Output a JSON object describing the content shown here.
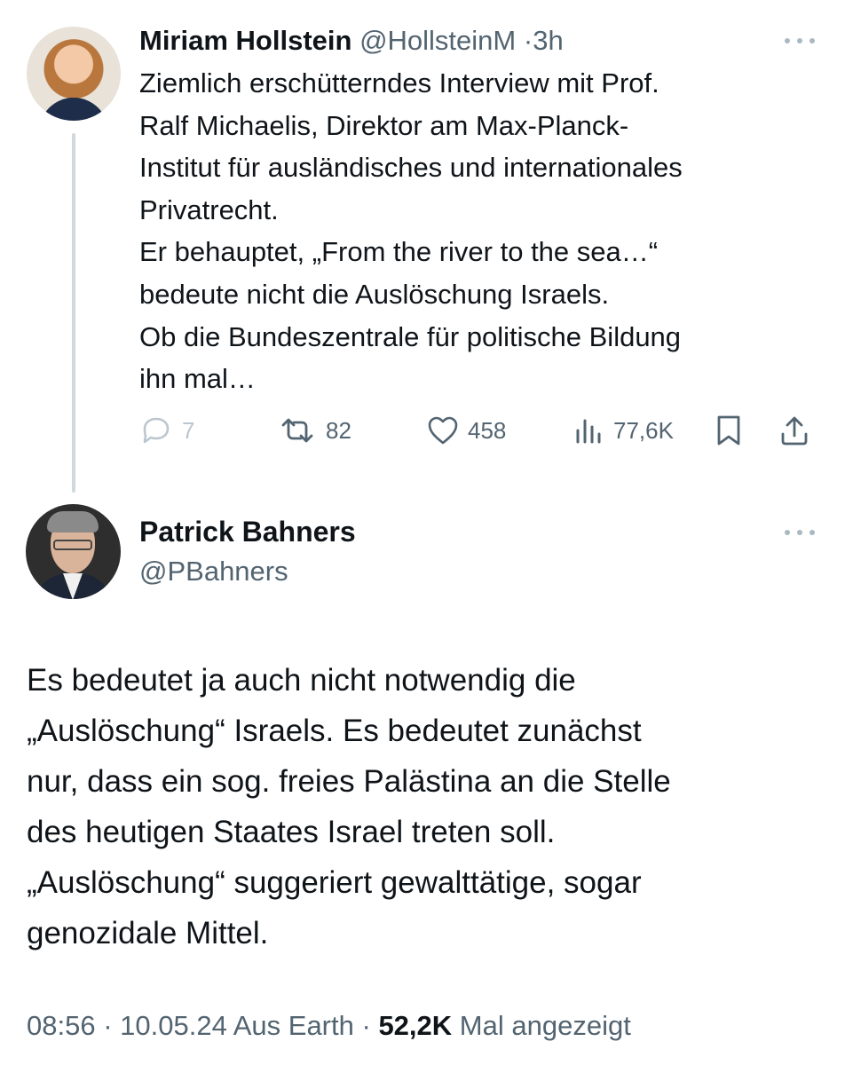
{
  "tweet1": {
    "author_name": "Miriam Hollstein",
    "handle": "@HollsteinM",
    "separator": "·",
    "time": "3h",
    "lines": [
      "Ziemlich erschütterndes Interview mit Prof.",
      "Ralf Michaelis, Direktor am Max-Planck-",
      "Institut für ausländisches und internationales",
      "Privatrecht.",
      "Er behauptet, „From the river to the sea…“",
      "bedeute nicht die Auslöschung Israels.",
      "Ob die Bundeszentrale für politische Bildung",
      "ihn mal…"
    ],
    "actions": {
      "replies": "7",
      "reposts": "82",
      "likes": "458",
      "views": "77,6K"
    }
  },
  "tweet2": {
    "author_name": "Patrick Bahners",
    "handle": "@PBahners",
    "lines": [
      "Es bedeutet ja auch nicht notwendig die",
      "„Auslöschung“ Israels. Es bedeutet zunächst",
      "nur, dass ein sog. freies Palästina an die Stelle",
      "des heutigen Staates Israel treten soll.",
      "„Auslöschung“ suggeriert gewalttätige, sogar",
      "genozidale Mittel."
    ],
    "footer": {
      "time": "08:56",
      "sep1": "·",
      "date": "10.05.24",
      "location": "Aus Earth",
      "sep2": "·",
      "views_count": "52,2K",
      "views_label": "Mal angezeigt"
    }
  },
  "colors": {
    "text": "#0f1419",
    "secondary": "#536471",
    "thread_line": "#cfd9de"
  }
}
